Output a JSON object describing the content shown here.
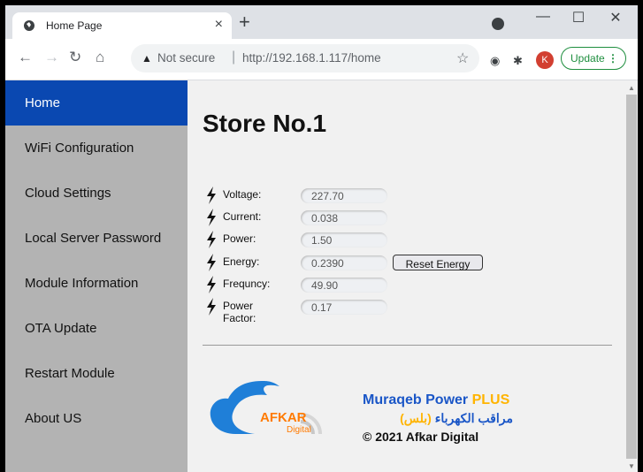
{
  "browser": {
    "tab_title": "Home Page",
    "tab_close": "×",
    "new_tab": "+",
    "not_secure": "Not secure",
    "url": "http://192.168.1.117/home",
    "profile_letter": "K",
    "update_label": "Update",
    "minimize": "—",
    "maximize": "☐",
    "close": "✕"
  },
  "sidebar": {
    "items": [
      {
        "label": "Home"
      },
      {
        "label": "WiFi Configuration"
      },
      {
        "label": "Cloud Settings"
      },
      {
        "label": "Local Server Password"
      },
      {
        "label": "Module Information"
      },
      {
        "label": "OTA Update"
      },
      {
        "label": "Restart Module"
      },
      {
        "label": "About US"
      }
    ]
  },
  "main": {
    "title": "Store No.1",
    "readings": [
      {
        "label": "Voltage:",
        "value": "227.70"
      },
      {
        "label": "Current:",
        "value": "0.038"
      },
      {
        "label": "Power:",
        "value": "1.50"
      },
      {
        "label": "Energy:",
        "value": "0.2390"
      },
      {
        "label": "Frequncy:",
        "value": "49.90"
      },
      {
        "label": "Power Factor:",
        "value": "0.17"
      }
    ],
    "reset_energy": "Reset Energy"
  },
  "footer": {
    "logo_main": "AFKAR",
    "logo_sub": "Digital",
    "brand_name": "Muraqeb Power",
    "brand_plus": "PLUS",
    "brand_arabic": "مراقب الكهرباء",
    "brand_arabic_plus": "(بلس)",
    "copyright": "© 2021 Afkar Digital"
  },
  "colors": {
    "sidebar_active": "#0a48b1",
    "sidebar_bg": "#b3b3b3",
    "brand_blue": "#1a56c7",
    "brand_orange": "#ffb400"
  }
}
